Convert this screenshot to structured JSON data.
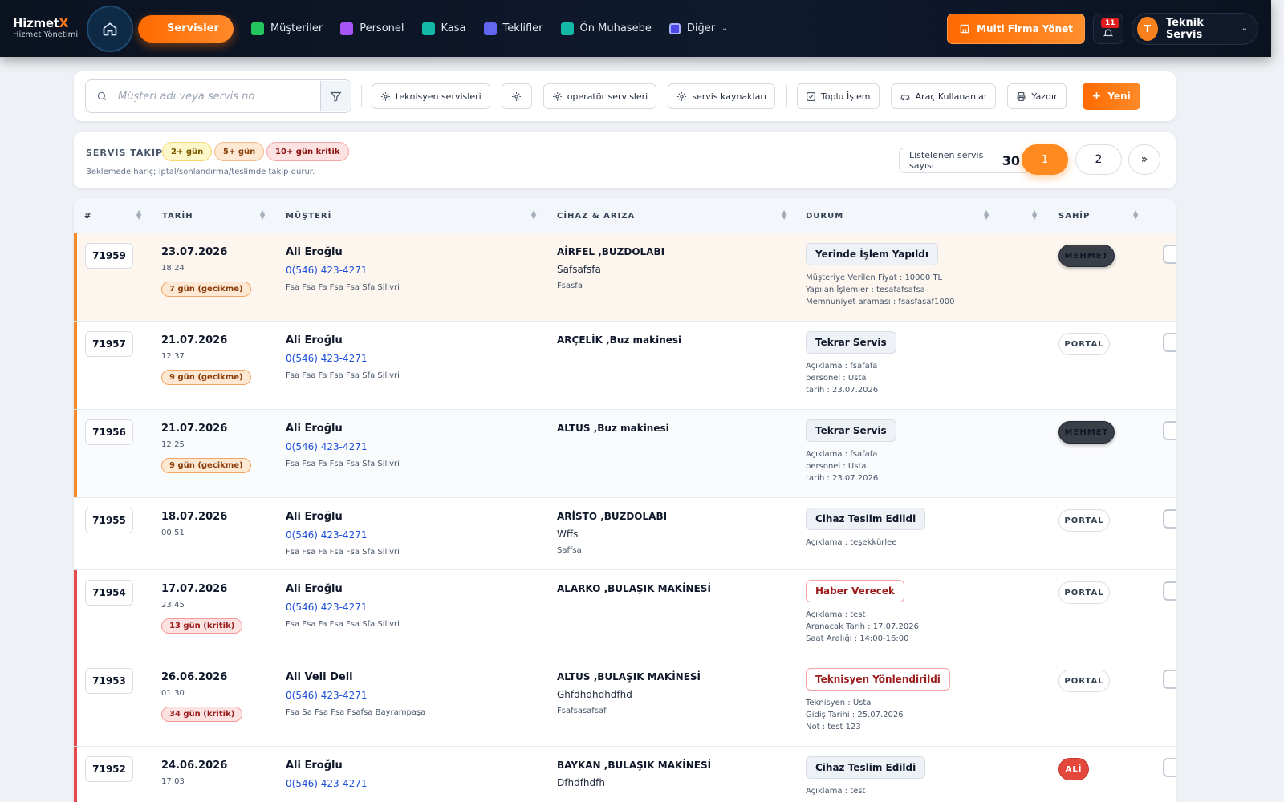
{
  "brand": {
    "name_main": "Hizmet",
    "name_accent": "X",
    "subtitle": "Hizmet Yönetimi"
  },
  "nav": {
    "items": [
      {
        "label": "Servisler",
        "color": "#ff6a00"
      },
      {
        "label": "Müşteriler",
        "color": "#22c55e"
      },
      {
        "label": "Personel",
        "color": "#a855f7"
      },
      {
        "label": "Kasa",
        "color": "#14b8a6"
      },
      {
        "label": "Teklifler",
        "color": "#6366f1"
      },
      {
        "label": "Ön Muhasebe",
        "color": "#14b8a6"
      },
      {
        "label": "Diğer",
        "color": "#6366f1"
      }
    ],
    "multi_firma": "Multi Firma Yönet",
    "notif_count": "11",
    "user_initial": "T",
    "user_name": "Teknik Servis"
  },
  "toolbar": {
    "search_placeholder": "Müşteri adı veya servis no",
    "btn_technician": "teknisyen servisleri",
    "btn_operator": "operatör servisleri",
    "btn_sources": "servis kaynakları",
    "btn_bulk": "Toplu İşlem",
    "btn_vehicle": "Araç Kullananlar",
    "btn_print": "Yazdır",
    "btn_new": "Yeni"
  },
  "tracking": {
    "title": "SERVİS TAKİP",
    "chip_2": "2+ gün",
    "chip_5": "5+ gün",
    "chip_10": "10+ gün kritik",
    "note": "Beklemede hariç; iptal/sonlandırma/teslimde takip durur.",
    "count_label": "Listelenen servis sayısı",
    "count_value": "30",
    "pages": [
      "1",
      "2",
      "»"
    ]
  },
  "table": {
    "headers": {
      "id": "#",
      "date": "TARİH",
      "customer": "MÜŞTERİ",
      "device": "CİHAZ & ARIZA",
      "status": "DURUM",
      "owner": "SAHİP"
    },
    "rows": [
      {
        "id": "71959",
        "date": "23.07.2026",
        "time": "18:24",
        "delay": "7 gün (gecikme)",
        "delay_type": "warn",
        "stripe": "#f28a2a",
        "bg": "#fdf6ef",
        "customer": "Ali Eroğlu",
        "phone": "0(546) 423-4271",
        "address": "Fsa Fsa Fa Fsa Fsa Sfa Silivri",
        "device": "AİRFEL ,BUZDOLABI",
        "fault": "Safsafsfa",
        "note": "Fsasfa",
        "status": "Yerinde İşlem Yapıldı",
        "status_type": "neutral",
        "details": [
          "Müşteriye Verilen Fiyat : 10000 TL",
          "Yapılan İşlemler : tesafafsafsa",
          "Memnuniyet araması : fsasfasaf1000"
        ],
        "owner": "MEHMET",
        "owner_type": "mehmet",
        "height": 110
      },
      {
        "id": "71957",
        "date": "21.07.2026",
        "time": "12:37",
        "delay": "9 gün (gecikme)",
        "delay_type": "warn",
        "stripe": "#f28a2a",
        "bg": "#ffffff",
        "customer": "Ali Eroğlu",
        "phone": "0(546) 423-4271",
        "address": "Fsa Fsa Fa Fsa Fsa Sfa Silivri",
        "device": "ARÇELİK ,Buz makinesi",
        "fault": "",
        "note": "",
        "status": "Tekrar Servis",
        "status_type": "neutral",
        "details": [
          "Açıklama : fsafafa",
          "personel : Usta",
          "tarih : 23.07.2026"
        ],
        "owner": "PORTAL",
        "owner_type": "portal",
        "height": 110
      },
      {
        "id": "71956",
        "date": "21.07.2026",
        "time": "12:25",
        "delay": "9 gün (gecikme)",
        "delay_type": "warn",
        "stripe": "#f28a2a",
        "bg": "#fafbfc",
        "customer": "Ali Eroğlu",
        "phone": "0(546) 423-4271",
        "address": "Fsa Fsa Fa Fsa Fsa Sfa Silivri",
        "device": "ALTUS ,Buz makinesi",
        "fault": "",
        "note": "",
        "status": "Tekrar Servis",
        "status_type": "neutral",
        "details": [
          "Açıklama : fsafafa",
          "personel : Usta",
          "tarih : 23.07.2026"
        ],
        "owner": "MEHMET",
        "owner_type": "mehmet",
        "height": 110
      },
      {
        "id": "71955",
        "date": "18.07.2026",
        "time": "00:51",
        "delay": "",
        "delay_type": "",
        "stripe": "",
        "bg": "#ffffff",
        "customer": "Ali Eroğlu",
        "phone": "0(546) 423-4271",
        "address": "Fsa Fsa Fa Fsa Fsa Sfa Silivri",
        "device": "ARİSTO ,BUZDOLABI",
        "fault": "Wffs",
        "note": "Saffsa",
        "status": "Cihaz Teslim Edildi",
        "status_type": "neutral",
        "details": [
          "Açıklama : teşekkürlee"
        ],
        "owner": "PORTAL",
        "owner_type": "portal",
        "height": 90
      },
      {
        "id": "71954",
        "date": "17.07.2026",
        "time": "23:45",
        "delay": "13 gün (kritik)",
        "delay_type": "crit",
        "stripe": "#e5484d",
        "bg": "#ffffff",
        "customer": "Ali Eroğlu",
        "phone": "0(546) 423-4271",
        "address": "Fsa Fsa Fa Fsa Fsa Sfa Silivri",
        "device": "ALARKO ,BULAŞIK MAKİNESİ",
        "fault": "",
        "note": "",
        "status": "Haber Verecek",
        "status_type": "alert",
        "details": [
          "Açıklama : test",
          "Aranacak Tarih : 17.07.2026",
          "Saat Aralığı : 14:00-16:00"
        ],
        "owner": "PORTAL",
        "owner_type": "portal",
        "height": 110
      },
      {
        "id": "71953",
        "date": "26.06.2026",
        "time": "01:30",
        "delay": "34 gün (kritik)",
        "delay_type": "crit",
        "stripe": "#e5484d",
        "bg": "#ffffff",
        "customer": "Ali Veli Deli",
        "phone": "0(546) 423-4271",
        "address": "Fsa Sa Fsa Fsa Fsafsa Bayrampaşa",
        "device": "ALTUS ,BULAŞIK MAKİNESİ",
        "fault": "Ghfdhdhdhdfhd",
        "note": "Fsafsasafsaf",
        "status": "Teknisyen Yönlendirildi",
        "status_type": "alert",
        "details": [
          "Teknisyen : Usta",
          "Gidiş Tarihi : 25.07.2026",
          "Not : test 123"
        ],
        "owner": "PORTAL",
        "owner_type": "portal",
        "height": 110
      },
      {
        "id": "71952",
        "date": "24.06.2026",
        "time": "17:03",
        "delay": "",
        "delay_type": "",
        "stripe": "#e5484d",
        "bg": "#ffffff",
        "customer": "Ali Eroğlu",
        "phone": "0(546) 423-4271",
        "address": "",
        "device": "BAYKAN ,BULAŞIK MAKİNESİ",
        "fault": "Dfhdfhdfh",
        "note": "",
        "status": "Cihaz Teslim Edildi",
        "status_type": "neutral",
        "details": [
          "Açıklama : test"
        ],
        "owner": "ALİ",
        "owner_type": "ali",
        "height": 110
      }
    ]
  }
}
